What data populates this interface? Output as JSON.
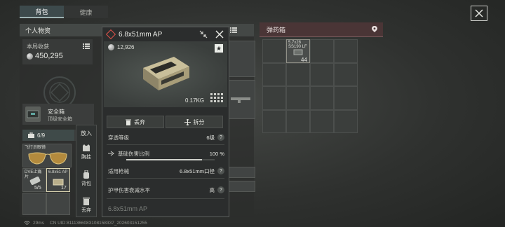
{
  "tabs": [
    {
      "label": "背包",
      "active": true
    },
    {
      "label": "健康",
      "active": false
    }
  ],
  "left_panel": {
    "title": "个人物资",
    "income_label": "本局收获",
    "income_value": "450,295",
    "safebox": {
      "title": "安全箱",
      "subtitle": "顶级安全箱"
    },
    "bag_capacity": "6/9",
    "slots": [
      {
        "label": "飞行员眼镜"
      },
      {
        "label": "DVE止痛片",
        "count": "5/5"
      },
      {
        "label": "6.8x51 AP",
        "count": "17"
      }
    ]
  },
  "context_menu": {
    "title": "放入",
    "items": [
      {
        "label": "胸挂",
        "icon": "vest-icon"
      },
      {
        "label": "背包",
        "icon": "backpack-icon"
      },
      {
        "label": "丢弃",
        "icon": "trash-icon"
      }
    ]
  },
  "ammo_box": {
    "title": "弹药箱",
    "item": {
      "label_line1": "5.7x28",
      "label_line2": "SS190 LF",
      "count": "44"
    }
  },
  "popup": {
    "title": "6.8x51mm AP",
    "price": "12,926",
    "weight": "0.17KG",
    "buttons": {
      "discard": "丢弃",
      "split": "拆分"
    },
    "stats": [
      {
        "label": "穿透等级",
        "value": "6级"
      },
      {
        "label": "基础伤害比例",
        "value": "100 %",
        "bar": 0.86
      },
      {
        "label": "适用枪械",
        "value": "6.8x51mm口径"
      },
      {
        "label": "护甲伤害衰减水平",
        "value": "高"
      }
    ],
    "footer": "6.8x51mm AP"
  },
  "status_bar": {
    "ping": "29ms",
    "uid": "CN UID:8111366083108158337_202603151255"
  },
  "colors": {
    "accent_red": "#e0524a",
    "ammo_header": "#4a3536",
    "active_tab": "#3d4a4c"
  }
}
